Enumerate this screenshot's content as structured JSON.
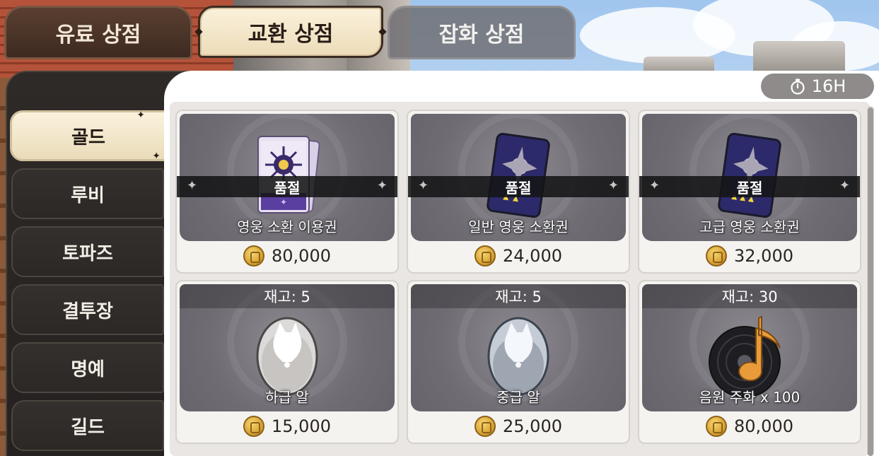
{
  "top_tabs": [
    {
      "label": "유료 상점"
    },
    {
      "label": "교환 상점"
    },
    {
      "label": "잡화 상점"
    }
  ],
  "active_top_tab": 1,
  "timer": {
    "value": "16H",
    "icon": "stopwatch-icon"
  },
  "side_menu": [
    {
      "label": "골드"
    },
    {
      "label": "루비"
    },
    {
      "label": "토파즈"
    },
    {
      "label": "결투장"
    },
    {
      "label": "명예"
    },
    {
      "label": "길드"
    }
  ],
  "active_side_item": 0,
  "shop_items": [
    {
      "name": "영웅 소환 이용권",
      "price": "80,000",
      "sold_out": true,
      "sold_out_label": "품절",
      "icon": "hero-summon-ticket-icon"
    },
    {
      "name": "일반 영웅 소환권",
      "price": "24,000",
      "sold_out": true,
      "sold_out_label": "품절",
      "icon": "normal-hero-summon-card-icon"
    },
    {
      "name": "고급 영웅 소환권",
      "price": "32,000",
      "sold_out": true,
      "sold_out_label": "품절",
      "icon": "premium-hero-summon-card-icon"
    },
    {
      "name": "하급 알",
      "price": "15,000",
      "stock": "재고: 5",
      "icon": "low-grade-egg-icon"
    },
    {
      "name": "중급 알",
      "price": "25,000",
      "stock": "재고: 5",
      "icon": "mid-grade-egg-icon"
    },
    {
      "name": "음원 주화 x 100",
      "price": "80,000",
      "stock": "재고: 30",
      "icon": "music-record-coin-icon"
    }
  ],
  "currency_icon": "gold-coin-icon",
  "colors": {
    "active_tab_bg": "#f3e6c9",
    "dark_panel": "#2a2624",
    "card_art_bg": "#6f6c74",
    "sold_out_band": "#141416",
    "timer_bg": "#8e8b8a"
  }
}
